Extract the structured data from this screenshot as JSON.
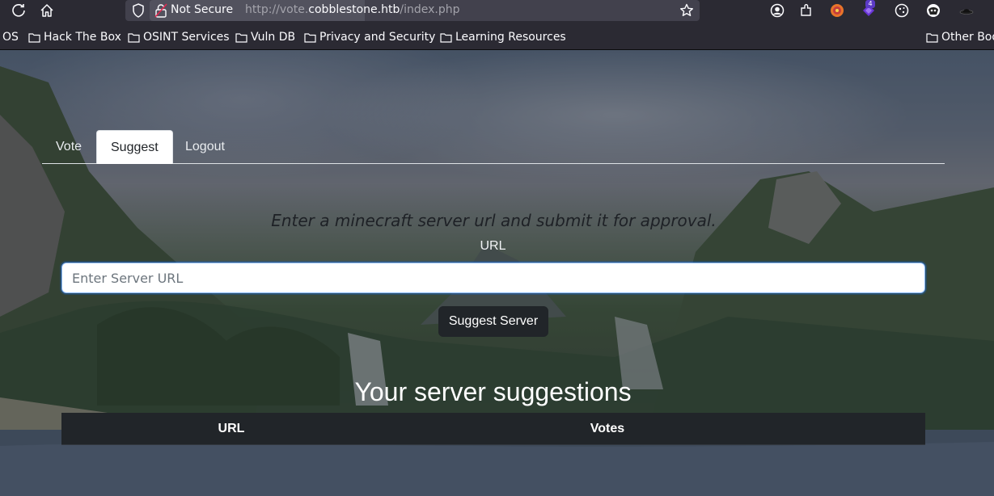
{
  "browser": {
    "security_label": "Not Secure",
    "url_prefix": "http://vote.",
    "url_domain": "cobblestone.htb",
    "url_path": "/index.php",
    "extension_badge": "4",
    "icons": [
      "reload-icon",
      "home-icon",
      "shield-icon",
      "lock-icon",
      "star-icon",
      "account-icon",
      "extensions-icon",
      "extension-icons"
    ]
  },
  "bookmarks": {
    "items": [
      {
        "label": "OS"
      },
      {
        "label": "Hack The Box"
      },
      {
        "label": "OSINT Services"
      },
      {
        "label": "Vuln DB"
      },
      {
        "label": "Privacy and Security"
      },
      {
        "label": "Learning Resources"
      },
      {
        "label": "Other Boo"
      }
    ]
  },
  "nav": {
    "tabs": [
      {
        "label": "Vote"
      },
      {
        "label": "Suggest",
        "active": true
      },
      {
        "label": "Logout"
      }
    ]
  },
  "suggest": {
    "intro": "Enter a minecraft server url and submit it for approval.",
    "url_label": "URL",
    "placeholder": "Enter Server URL",
    "submit_label": "Suggest Server"
  },
  "suggestions": {
    "title": "Your server suggestions",
    "columns": [
      "URL",
      "Votes"
    ]
  },
  "colors": {
    "chrome_bg": "#2b2a33",
    "urlbar_bg": "#42414d",
    "tab_active_bg": "#ffffff",
    "button_bg": "#212529",
    "table_header_bg": "#212529",
    "input_focus_border": "#86b7fe"
  }
}
